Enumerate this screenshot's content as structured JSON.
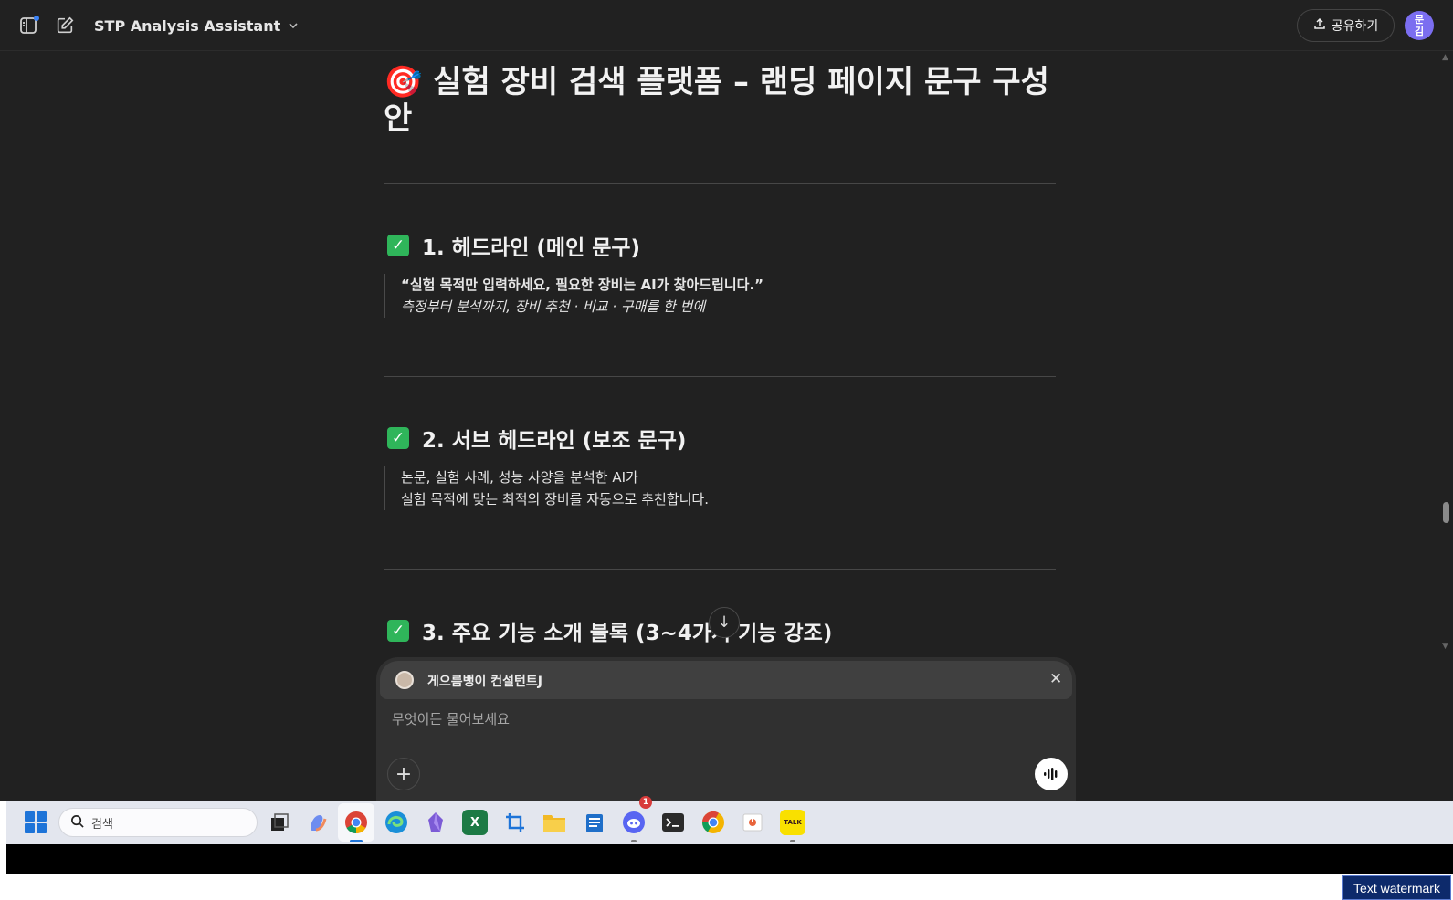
{
  "header": {
    "title": "STP Analysis Assistant",
    "share_label": "공유하기",
    "avatar_text": "문\n김",
    "icons": {
      "sidebar": "sidebar-toggle-icon",
      "new_chat": "edit-icon",
      "dropdown": "chevron-down-icon",
      "share": "upload-icon"
    }
  },
  "article": {
    "title": "🎯 실험 장비 검색 플랫폼 – 랜딩 페이지 문구 구성안",
    "sections": [
      {
        "heading": "1. 헤드라인 (메인 문구)",
        "quote_line1": "“실험 목적만 입력하세요, 필요한 장비는 AI가 찾아드립니다.”",
        "quote_line2": "측정부터 분석까지, 장비 추천 · 비교 · 구매를 한 번에"
      },
      {
        "heading": "2. 서브 헤드라인 (보조 문구)",
        "quote_line1": "논문, 실험 사례, 성능 사양을 분석한 AI가",
        "quote_line2": "실험 목적에 맞는 최적의 장비를 자동으로 추천합니다."
      },
      {
        "heading": "3. 주요 기능 소개 블록 (3~4가지 기능 강조)"
      }
    ],
    "check_glyph": "✓",
    "scroll_down_glyph": "↓"
  },
  "composer": {
    "gpt_name": "게으름뱅이 컨설턴트J",
    "close_glyph": "✕",
    "placeholder": "무엇이든 물어보세요",
    "plus_glyph": "+",
    "voice_icon": "voice-mode-icon"
  },
  "taskbar": {
    "search_placeholder": "검색",
    "apps": [
      "task-view",
      "copilot",
      "chrome",
      "edge",
      "obsidian",
      "excel",
      "snipping-tool",
      "file-explorer",
      "notepad",
      "discord",
      "terminal",
      "chrome-alt",
      "powerpoint",
      "kakaotalk"
    ],
    "discord_badge": "1",
    "excel_letter": "X",
    "kakao_label": "TALK"
  },
  "watermark": "Text watermark",
  "colors": {
    "background": "#212121",
    "check": "#2fb55a",
    "avatar": "#7b6ef0",
    "taskbar": "#e3e6ee",
    "watermark_bg": "#0d2a6b"
  }
}
